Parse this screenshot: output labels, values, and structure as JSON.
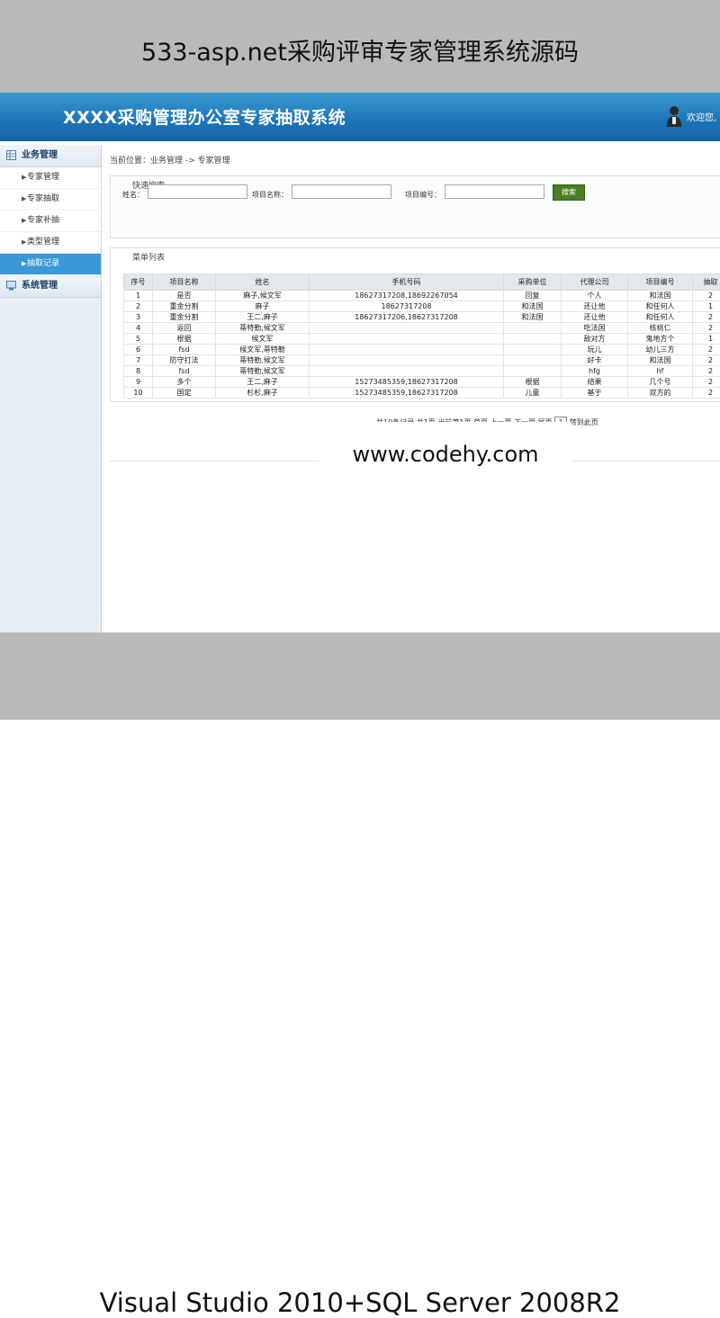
{
  "banner": {
    "top_title": "533-asp.net采购评审专家管理系统源码",
    "bottom_title": "Visual Studio 2010+SQL Server 2008R2",
    "watermark": "www.codehy.com"
  },
  "header": {
    "title": "XXXX采购管理办公室专家抽取系统",
    "welcome": "欢迎您,"
  },
  "sidebar": {
    "groups": [
      {
        "label": "业务管理",
        "items": [
          {
            "label": "专家管理"
          },
          {
            "label": "专家抽取"
          },
          {
            "label": "专家补抽"
          },
          {
            "label": "类型管理"
          },
          {
            "label": "抽取记录"
          }
        ]
      },
      {
        "label": "系统管理"
      }
    ]
  },
  "breadcrumb": "当前位置：业务管理 -> 专家管理",
  "search": {
    "title": "快速搜索",
    "name_label": "姓名：",
    "project_label": "项目名称：",
    "number_label": "项目编号：",
    "button": "搜索"
  },
  "list": {
    "title": "菜单列表",
    "columns": [
      "序号",
      "项目名称",
      "姓名",
      "手机号码",
      "采购单位",
      "代理公司",
      "项目编号",
      "抽取"
    ],
    "rows": [
      [
        "1",
        "是否",
        "麻子,候文军",
        "18627317208,18692267054",
        "回复",
        "个人",
        "和法国",
        "2"
      ],
      [
        "2",
        "重金分割",
        "麻子",
        "18627317208",
        "和法国",
        "还让他",
        "和任何人",
        "1"
      ],
      [
        "3",
        "重金分割",
        "王二,麻子",
        "18627317206,18627317208",
        "和法国",
        "还让他",
        "和任何人",
        "2"
      ],
      [
        "4",
        "返回",
        "蒂特勒,候文军",
        "",
        "",
        "吃法国",
        "核桃仁",
        "2"
      ],
      [
        "5",
        "根据",
        "候文军",
        "",
        "",
        "敌对方",
        "鬼地方个",
        "1"
      ],
      [
        "6",
        "fsd",
        "候文军,蒂特勒",
        "",
        "",
        "玩儿",
        "幼儿三方",
        "2"
      ],
      [
        "7",
        "防守打法",
        "蒂特勒,候文军",
        "",
        "",
        "好卡",
        "和法国",
        "2"
      ],
      [
        "8",
        "fsd",
        "蒂特勒,候文军",
        "",
        "",
        "hfg",
        "hf",
        "2"
      ],
      [
        "9",
        "多个",
        "王二,麻子",
        "15273485359,18627317208",
        "根据",
        "结果",
        "几个号",
        "2"
      ],
      [
        "10",
        "国定",
        "杉杉,麻子",
        "15273485359,18627317208",
        "儿童",
        "基于",
        "双方的",
        "2"
      ]
    ]
  },
  "pager": {
    "text": "共10条记录,共1页,当前第1页 首页 上一页 下一页 尾页",
    "page_value": "1",
    "jump": "转到此页"
  }
}
